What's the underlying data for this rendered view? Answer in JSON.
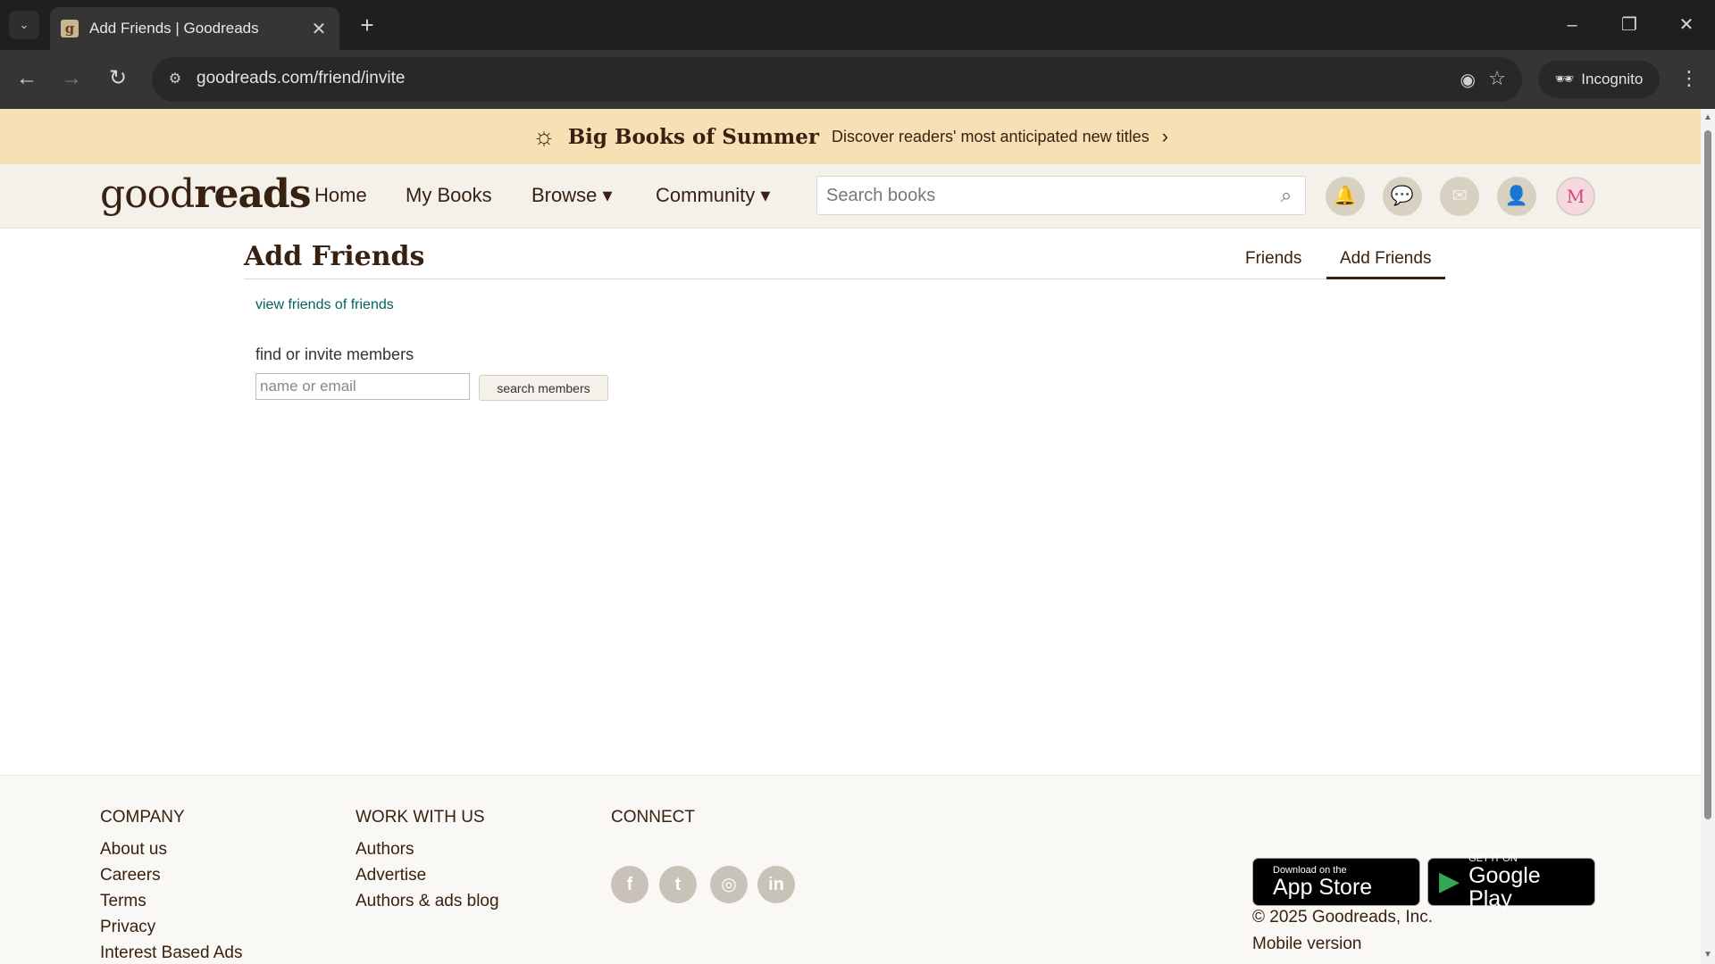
{
  "browser": {
    "tab_title": "Add Friends | Goodreads",
    "favicon_letter": "g",
    "url": "goodreads.com/friend/invite",
    "incognito_label": "Incognito"
  },
  "banner": {
    "headline": "Big Books of Summer",
    "subtext": "Discover readers' most anticipated new titles"
  },
  "header": {
    "logo_light": "good",
    "logo_bold": "reads",
    "nav": {
      "home": "Home",
      "my_books": "My Books",
      "browse": "Browse ▾",
      "community": "Community ▾"
    },
    "search_placeholder": "Search books",
    "avatar_letter": "M"
  },
  "main": {
    "title": "Add Friends",
    "subnav": {
      "friends": "Friends",
      "add_friends": "Add Friends"
    },
    "view_fof_link": "view friends of friends",
    "find_label": "find or invite members",
    "member_input_placeholder": "name or email",
    "search_button": "search members"
  },
  "footer": {
    "company": {
      "heading": "Company",
      "links": [
        "About us",
        "Careers",
        "Terms",
        "Privacy",
        "Interest Based Ads"
      ]
    },
    "work_with_us": {
      "heading": "Work with us",
      "links": [
        "Authors",
        "Advertise",
        "Authors & ads blog"
      ]
    },
    "connect": {
      "heading": "Connect",
      "icons": [
        "facebook-icon",
        "twitter-icon",
        "instagram-icon",
        "linkedin-icon"
      ]
    },
    "app_store": {
      "small": "Download on the",
      "big": "App Store"
    },
    "google_play": {
      "small": "GET IT ON",
      "big": "Google Play"
    },
    "copyright": "© 2025 Goodreads, Inc.",
    "mobile_version": "Mobile version"
  },
  "colors": {
    "brand_brown": "#382110",
    "link_teal": "#00635d",
    "banner_bg": "#f8e0b6",
    "header_bg": "#f4f1ea"
  }
}
